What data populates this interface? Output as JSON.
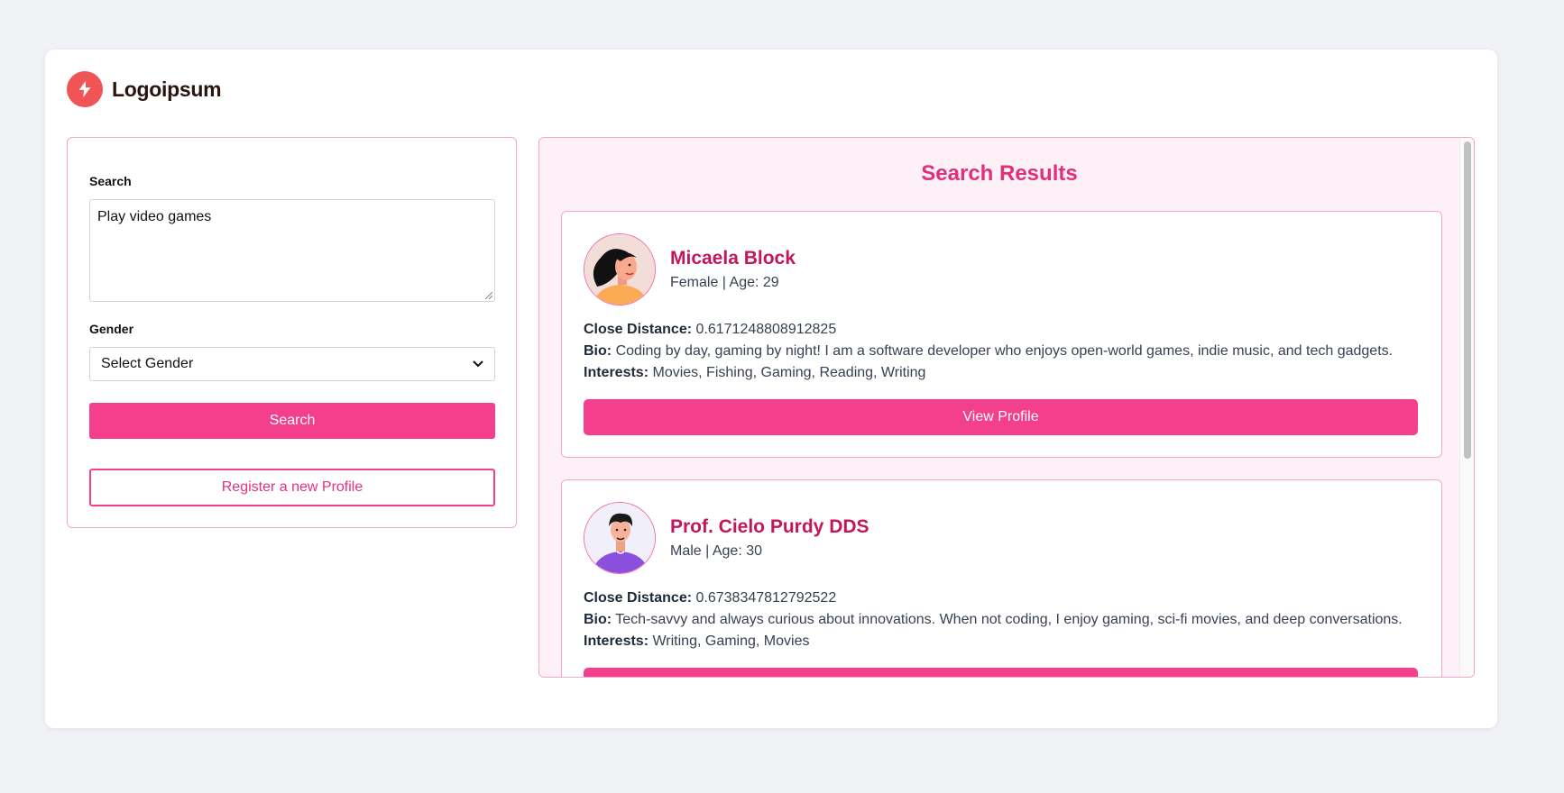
{
  "brand": {
    "name": "Logoipsum",
    "logo_icon": "lightning-bolt-icon",
    "color": "#f05454"
  },
  "search_panel": {
    "search_label": "Search",
    "search_value": "Play video games",
    "gender_label": "Gender",
    "gender_selected": "Select Gender",
    "search_button": "Search",
    "register_button": "Register a new Profile"
  },
  "results": {
    "title": "Search Results",
    "close_distance_label": "Close Distance:",
    "bio_label": "Bio:",
    "interests_label": "Interests:",
    "view_button": "View Profile",
    "items": [
      {
        "name": "Micaela Block",
        "meta": "Female | Age: 29",
        "close_distance": "0.6171248808912825",
        "bio": "Coding by day, gaming by night! I am a software developer who enjoys open-world games, indie music, and tech gadgets.",
        "interests": "Movies, Fishing, Gaming, Reading, Writing"
      },
      {
        "name": "Prof. Cielo Purdy DDS",
        "meta": "Male | Age: 30",
        "close_distance": "0.6738347812792522",
        "bio": "Tech-savvy and always curious about innovations. When not coding, I enjoy gaming, sci-fi movies, and deep conversations.",
        "interests": "Writing, Gaming, Movies"
      }
    ]
  },
  "colors": {
    "accent": "#f43f8c",
    "heading": "#e0307a",
    "name": "#c2185b"
  }
}
